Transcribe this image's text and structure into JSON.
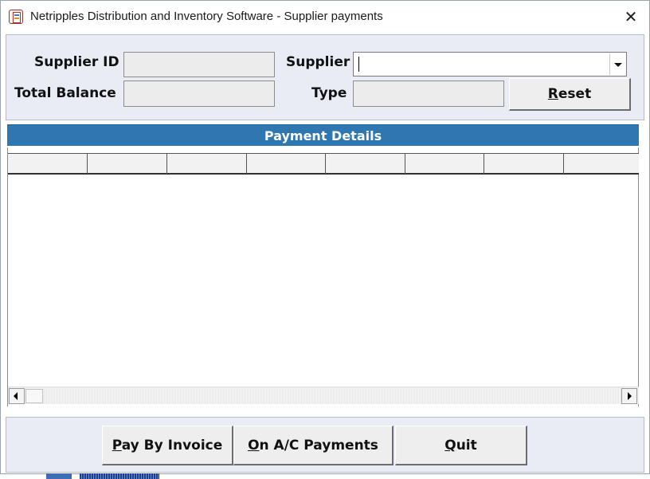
{
  "window": {
    "title": "Netripples Distribution and Inventory Software - Supplier payments",
    "close_glyph": "✕",
    "app_icon": "ledger-app-icon"
  },
  "form": {
    "supplier_id_label": "Supplier ID",
    "supplier_id_value": "",
    "total_balance_label": "Total Balance",
    "total_balance_value": "",
    "supplier_label": "Supplier",
    "supplier_value": "",
    "type_label": "Type",
    "type_value": ""
  },
  "buttons": {
    "reset_mnemonic": "R",
    "reset_rest": "eset",
    "pay_by_invoice_mnemonic": "P",
    "pay_by_invoice_rest": "ay By Invoice",
    "on_ac_mnemonic": "O",
    "on_ac_rest": "n A/C Payments",
    "quit_mnemonic": "Q",
    "quit_rest": "uit"
  },
  "payment_details": {
    "header": "Payment Details",
    "columns": [
      "",
      "",
      "",
      "",
      "",
      "",
      "",
      ""
    ],
    "rows": []
  },
  "colors": {
    "section_header_bg": "#2f77b0",
    "panel_bg": "#e9ebf5"
  }
}
